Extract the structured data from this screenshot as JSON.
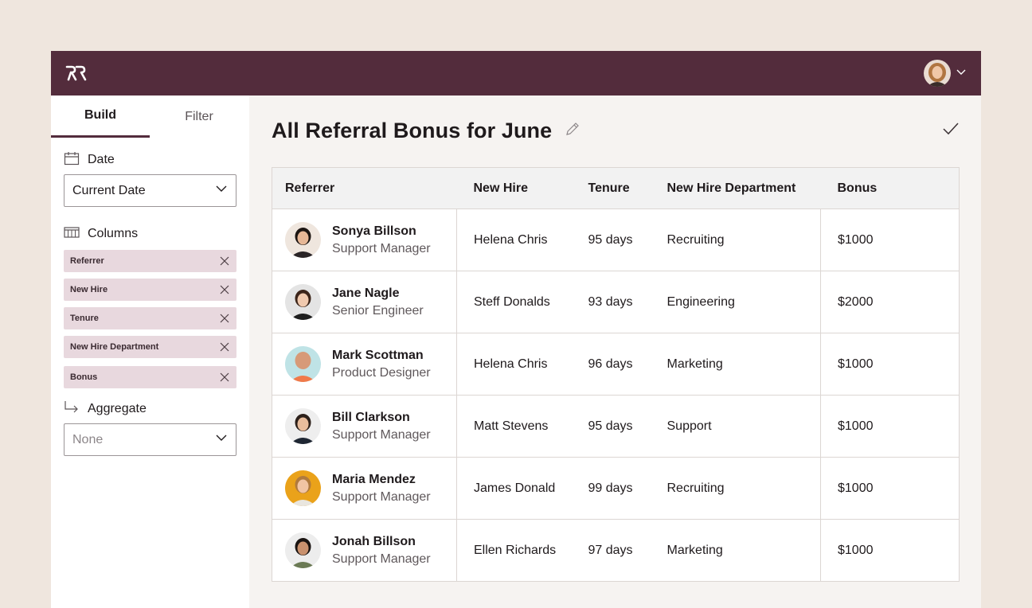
{
  "header": {
    "logo": "RR"
  },
  "sidebar": {
    "tabs": [
      "Build",
      "Filter"
    ],
    "date": {
      "label": "Date",
      "value": "Current Date"
    },
    "columns": {
      "label": "Columns",
      "chips": [
        "Referrer",
        "New Hire",
        "Tenure",
        "New Hire Department",
        "Bonus"
      ]
    },
    "aggregate": {
      "label": "Aggregate",
      "placeholder": "None"
    }
  },
  "main": {
    "title": "All Referral Bonus for June",
    "table": {
      "headers": [
        "Referrer",
        "New Hire",
        "Tenure",
        "New Hire Department",
        "Bonus"
      ],
      "rows": [
        {
          "name": "Sonya Billson",
          "role": "Support Manager",
          "new_hire": "Helena Chris",
          "tenure": "95 days",
          "department": "Recruiting",
          "bonus": "$1000",
          "avatar_bg": "#efe6de",
          "skin": "#e6b796",
          "hair": "#1c1512",
          "shirt": "#2a2426"
        },
        {
          "name": "Jane Nagle",
          "role": "Senior Engineer",
          "new_hire": "Steff Donalds",
          "tenure": "93 days",
          "department": "Engineering",
          "bonus": "$2000",
          "avatar_bg": "#e4e4e4",
          "skin": "#f0c9ae",
          "hair": "#3b2419",
          "shirt": "#1e1e1e"
        },
        {
          "name": "Mark Scottman",
          "role": "Product Designer",
          "new_hire": "Helena Chris",
          "tenure": "96 days",
          "department": "Marketing",
          "bonus": "$1000",
          "avatar_bg": "#bfe3e6",
          "skin": "#d79a78",
          "hair": "#d79a78",
          "shirt": "#f07a4a"
        },
        {
          "name": "Bill Clarkson",
          "role": "Support Manager",
          "new_hire": "Matt Stevens",
          "tenure": "95 days",
          "department": "Support",
          "bonus": "$1000",
          "avatar_bg": "#eeeeee",
          "skin": "#e9bd9c",
          "hair": "#2d211b",
          "shirt": "#1f2733"
        },
        {
          "name": "Maria Mendez",
          "role": "Support Manager",
          "new_hire": "James Donald",
          "tenure": "99 days",
          "department": "Recruiting",
          "bonus": "$1000",
          "avatar_bg": "#eaa21a",
          "skin": "#f1c4a4",
          "hair": "#b07a3d",
          "shirt": "#e9e6df"
        },
        {
          "name": "Jonah Billson",
          "role": "Support Manager",
          "new_hire": "Ellen Richards",
          "tenure": "97 days",
          "department": "Marketing",
          "bonus": "$1000",
          "avatar_bg": "#ededed",
          "skin": "#c9916e",
          "hair": "#1a1412",
          "shirt": "#6b7a55"
        }
      ]
    }
  },
  "colors": {
    "brand": "#532c3c",
    "chip": "#e8d8de",
    "background": "#efe6de"
  },
  "icons": [
    "logo-icon",
    "avatar",
    "chevron-down-icon",
    "calendar-icon",
    "columns-icon",
    "close-icon",
    "aggregate-arrow-icon",
    "pencil-icon",
    "check-icon"
  ]
}
